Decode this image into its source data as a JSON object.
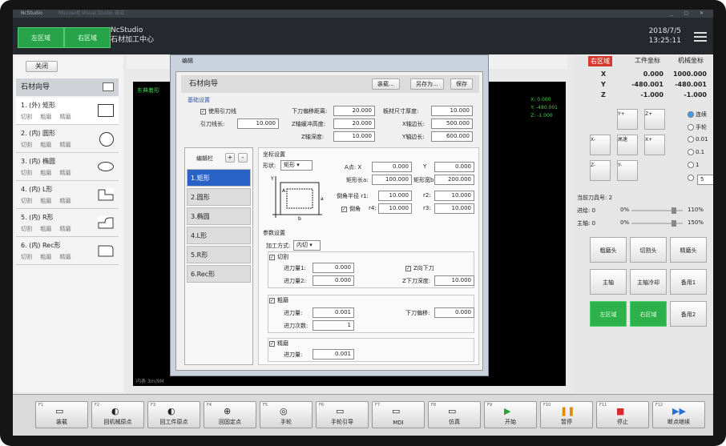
{
  "titlebar": {
    "app": "NcStudio",
    "faded": "Microsoft Visual Studio 调试"
  },
  "header": {
    "left_zone": "左区域",
    "right_zone": "右区域",
    "title1": "NcStudio",
    "title2": "石材加工中心",
    "date": "2018/7/5",
    "time": "13:25:11"
  },
  "left": {
    "close": "关闭",
    "wizard": "石材向导",
    "shapes": [
      {
        "name": "1. (外) 矩形",
        "ops": "切割 粗磨 精磨"
      },
      {
        "name": "2. (内) 圆形",
        "ops": "切割 粗磨 精磨"
      },
      {
        "name": "3. (内) 椭圆",
        "ops": "切割 粗磨 精磨"
      },
      {
        "name": "4. (内) L形",
        "ops": "切割 粗磨 精磨"
      },
      {
        "name": "5. (内) R形",
        "ops": "切割 粗磨 精磨"
      },
      {
        "name": "6. (内) Rec形",
        "ops": "切割 粗磨 精磨"
      }
    ]
  },
  "canvas": {
    "label": "东典着形",
    "x": "X:    0.000",
    "y": "Y:  -480.001",
    "z": "Z:   -1.000",
    "footer": "内表 3m/9M"
  },
  "right": {
    "tabs": [
      "右区域",
      "工件坐标",
      "机械坐标"
    ],
    "coords": [
      {
        "axis": "X",
        "work": "0.000",
        "mach": "1000.000"
      },
      {
        "axis": "Y",
        "work": "-480.001",
        "mach": "-480.001"
      },
      {
        "axis": "Z",
        "work": "-1.000",
        "mach": "-1.000"
      }
    ],
    "jog": {
      "y_plus": "Y+",
      "z_plus": "Z+",
      "x_minus": "X-",
      "high_speed": "高速",
      "x_plus": "X+",
      "z_minus": "Z-",
      "y_minus": "Y-"
    },
    "modes": [
      "连续",
      "手轮",
      "0.01",
      "0.1",
      "1"
    ],
    "step_value": "5",
    "tool_no": "当前刀具号: 2",
    "feed": {
      "label": "进给: 0",
      "min": "0%",
      "max": "110%"
    },
    "spindle": {
      "label": "主轴: 0",
      "min": "0%",
      "max": "150%"
    },
    "buttons": [
      "粗磨头",
      "切割头",
      "精磨头",
      "主轴",
      "主轴冷却",
      "备用1",
      "左区域",
      "右区域",
      "备用2"
    ]
  },
  "dialog": {
    "title": "编辑",
    "header": "石材向导",
    "btn_load": "装载...",
    "btn_saveas": "另存为...",
    "btn_save": "保存",
    "basic": "基础设置",
    "use_lead": "使用引刀线",
    "lead_len_label": "引刀线长:",
    "lead_len": "10.000",
    "down_offset_label": "下刀偏移距离:",
    "down_offset": "20.000",
    "plate_thick_label": "板材尺寸厚度:",
    "plate_thick": "10.000",
    "z_safe_label": "Z轴缓冲高度:",
    "z_safe": "20.000",
    "x_len_label": "X轴边长:",
    "x_len": "500.000",
    "z_depth_label": "Z轴深度:",
    "z_depth": "10.000",
    "y_len_label": "Y轴边长:",
    "y_len": "600.000",
    "editbar": "编辑栏",
    "items": [
      "1.矩形",
      "2.圆形",
      "3.椭圆",
      "4.L形",
      "5.R形",
      "6.Rec形"
    ],
    "coord_set": "坐标设置",
    "shape_label": "形状:",
    "shape_value": "矩形",
    "a_point": "A点: X",
    "ax": "0.000",
    "y_label": "Y",
    "ay": "0.000",
    "rect_len_label": "矩形长a:",
    "rect_len": "100.000",
    "rect_w_label": "矩形宽b:",
    "rect_w": "200.000",
    "corner_r_label": "倒角半径  r1:",
    "r1": "10.000",
    "r2_label": "r2:",
    "r2": "10.000",
    "corner_label": "倒角",
    "r4_label": "r4:",
    "r4": "10.000",
    "r3_label": "r3:",
    "r3": "10.000",
    "param_set": "参数设置",
    "process_label": "加工方式:",
    "process_value": "内切",
    "cut": "切割",
    "feed1_label": "进刀量1:",
    "feed1": "0.000",
    "z_down": "Z向下刀",
    "feed2_label": "进刀量2:",
    "feed2": "0.000",
    "z_down_depth_label": "Z下刀深度:",
    "z_down_depth": "10.000",
    "rough": "粗磨",
    "rough_feed_label": "进刀量:",
    "rough_feed": "0.001",
    "down_off_label": "下刀偏移:",
    "down_off": "0.000",
    "passes_label": "进刀次数:",
    "passes": "1",
    "fine": "精磨",
    "fine_feed_label": "进刀量:",
    "fine_feed": "0.001"
  },
  "fkeys": [
    {
      "k": "F1",
      "icon": "▭",
      "t": "装载"
    },
    {
      "k": "F2",
      "icon": "◐",
      "t": "回机械原点"
    },
    {
      "k": "F3",
      "icon": "◐",
      "t": "回工件原点"
    },
    {
      "k": "F4",
      "icon": "⊕",
      "t": "回固定点"
    },
    {
      "k": "F5",
      "icon": "◎",
      "t": "手轮"
    },
    {
      "k": "F6",
      "icon": "▭",
      "t": "手轮引导"
    },
    {
      "k": "F7",
      "icon": "▭",
      "t": "MDI"
    },
    {
      "k": "F8",
      "icon": "▭",
      "t": "仿真"
    },
    {
      "k": "F9",
      "icon": "▶",
      "t": "开始"
    },
    {
      "k": "F10",
      "icon": "❚❚",
      "t": "暂停"
    },
    {
      "k": "F11",
      "icon": "■",
      "t": "停止"
    },
    {
      "k": "F12",
      "icon": "▶▶",
      "t": "断点继续"
    }
  ]
}
